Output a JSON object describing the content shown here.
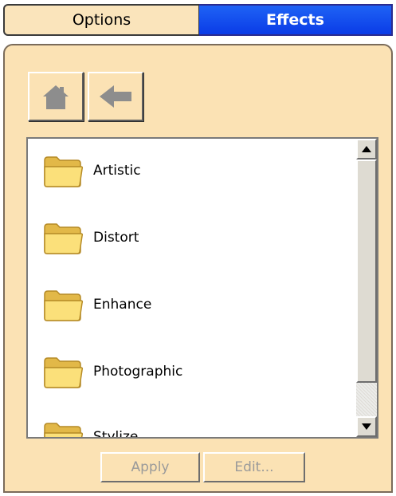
{
  "tabs": {
    "options": "Options",
    "effects": "Effects"
  },
  "nav": {
    "home_icon": "home-icon",
    "back_icon": "back-arrow-icon"
  },
  "list": {
    "items": [
      {
        "label": "Artistic",
        "icon": "folder-icon"
      },
      {
        "label": "Distort",
        "icon": "folder-icon"
      },
      {
        "label": "Enhance",
        "icon": "folder-icon"
      },
      {
        "label": "Photographic",
        "icon": "folder-icon"
      },
      {
        "label": "Stylize",
        "icon": "folder-icon"
      }
    ]
  },
  "buttons": {
    "apply": "Apply",
    "edit": "Edit..."
  },
  "colors": {
    "panel": "#fbe2b4",
    "active_tab": "#0a3be6",
    "folder": "#f8d96a"
  }
}
